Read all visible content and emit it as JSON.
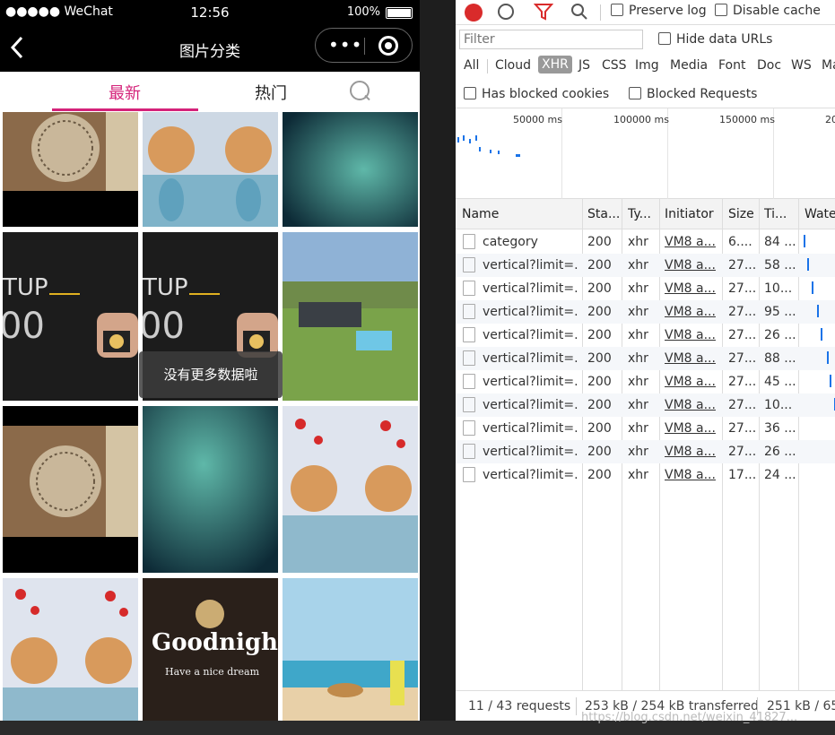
{
  "phone": {
    "status_bar": {
      "carrier": "●●●●● WeChat",
      "time": "12:56",
      "battery": "100%"
    },
    "title_bar": {
      "title": "图片分类",
      "back_icon": "chevron-left-icon"
    },
    "tabs": [
      {
        "label": "最新",
        "active": true
      },
      {
        "label": "热门",
        "active": false
      }
    ],
    "toast": "没有更多数据啦",
    "colors": {
      "accent": "#d4237a"
    }
  },
  "devtools": {
    "toolbar": {
      "preserve_log": "Preserve log",
      "disable_cache": "Disable cache"
    },
    "filter": {
      "placeholder": "Filter",
      "hide_data_urls": "Hide data URLs"
    },
    "types": [
      "All",
      "Cloud",
      "XHR",
      "JS",
      "CSS",
      "Img",
      "Media",
      "Font",
      "Doc",
      "WS",
      "Ma"
    ],
    "active_type": "XHR",
    "checkboxes2": {
      "has_blocked_cookies": "Has blocked cookies",
      "blocked_requests": "Blocked Requests"
    },
    "timeline_labels": [
      "50000 ms",
      "100000 ms",
      "150000 ms",
      "20"
    ],
    "columns": [
      "Name",
      "Sta...",
      "Ty...",
      "Initiator",
      "Size",
      "Ti...",
      "Water"
    ],
    "rows": [
      {
        "name": "category",
        "status": "200",
        "type": "xhr",
        "initiator": "VM8 a...",
        "size": "6....",
        "time": "84 ..."
      },
      {
        "name": "vertical?limit=...",
        "status": "200",
        "type": "xhr",
        "initiator": "VM8 a...",
        "size": "27...",
        "time": "58 ..."
      },
      {
        "name": "vertical?limit=...",
        "status": "200",
        "type": "xhr",
        "initiator": "VM8 a...",
        "size": "27...",
        "time": "10..."
      },
      {
        "name": "vertical?limit=...",
        "status": "200",
        "type": "xhr",
        "initiator": "VM8 a...",
        "size": "27...",
        "time": "95 ..."
      },
      {
        "name": "vertical?limit=...",
        "status": "200",
        "type": "xhr",
        "initiator": "VM8 a...",
        "size": "27...",
        "time": "26 ..."
      },
      {
        "name": "vertical?limit=...",
        "status": "200",
        "type": "xhr",
        "initiator": "VM8 a...",
        "size": "27...",
        "time": "88 ..."
      },
      {
        "name": "vertical?limit=...",
        "status": "200",
        "type": "xhr",
        "initiator": "VM8 a...",
        "size": "27...",
        "time": "45 ..."
      },
      {
        "name": "vertical?limit=...",
        "status": "200",
        "type": "xhr",
        "initiator": "VM8 a...",
        "size": "27...",
        "time": "10..."
      },
      {
        "name": "vertical?limit=...",
        "status": "200",
        "type": "xhr",
        "initiator": "VM8 a...",
        "size": "27...",
        "time": "36 ..."
      },
      {
        "name": "vertical?limit=...",
        "status": "200",
        "type": "xhr",
        "initiator": "VM8 a...",
        "size": "27...",
        "time": "26 ..."
      },
      {
        "name": "vertical?limit=...",
        "status": "200",
        "type": "xhr",
        "initiator": "VM8 a...",
        "size": "17...",
        "time": "24 ..."
      }
    ],
    "footer": {
      "requests": "11 / 43 requests",
      "transferred": "253 kB / 254 kB transferred",
      "resources": "251 kB / 65"
    }
  },
  "watermark": "https://blog.csdn.net/weixin_41827..."
}
